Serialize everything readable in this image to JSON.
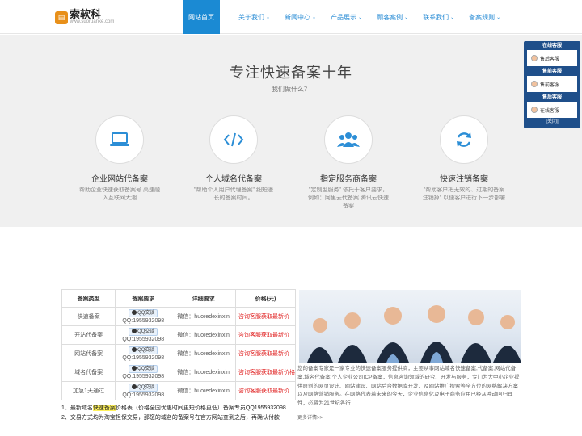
{
  "logo": {
    "text": "索软科",
    "sub": "www.suoruanke.com"
  },
  "nav": [
    {
      "label": "网站首页",
      "chev": ""
    },
    {
      "label": "关于我们",
      "chev": "⌄"
    },
    {
      "label": "新闻中心",
      "chev": "⌄"
    },
    {
      "label": "产品展示",
      "chev": "⌄"
    },
    {
      "label": "顾客案例",
      "chev": "⌄"
    },
    {
      "label": "联系我们",
      "chev": "⌄"
    },
    {
      "label": "备案规则",
      "chev": "⌄"
    }
  ],
  "hero": {
    "title": "专注快速备案十年",
    "subtitle": "我们做什么？"
  },
  "services": [
    {
      "icon": "laptop-icon",
      "title": "企业网站代备案",
      "desc": "帮助企业快速获取备案号 高速融入互联网大潮"
    },
    {
      "icon": "code-icon",
      "title": "个人域名代备案",
      "desc": "\"帮助个人用户代理备案\" 细短漫长的备案时间。"
    },
    {
      "icon": "users-icon",
      "title": "指定服务商备案",
      "desc": "\"定制型服务\" 依托于客户要求，例如：阿里云代备案 腾讯云快速备案"
    },
    {
      "icon": "refresh-icon",
      "title": "快速注销备案",
      "desc": "\"帮助客户把无效的、过期的备案注销掉\" 以便客户进行下一步部署"
    }
  ],
  "table": {
    "headers": [
      "备案类型",
      "备案要求",
      "详细要求",
      "价格(元)"
    ],
    "qq_label": "QQ交谈",
    "rows": [
      {
        "type": "快速备案",
        "qq": "QQ:1955932098",
        "wx": "微信：huoredexinxin",
        "price": "咨询客服获取最新价"
      },
      {
        "type": "开站代备案",
        "qq": "QQ:1955932098",
        "wx": "微信：huoredexinxin",
        "price": "咨询客服获取最新价"
      },
      {
        "type": "网站代备案",
        "qq": "QQ:1955932098",
        "wx": "微信：huoredexinxin",
        "price": "咨询客服获取最新价"
      },
      {
        "type": "域名代备案",
        "qq": "QQ:1955932098",
        "wx": "微信：huoredexinxin",
        "price": "咨询客服获取最新价格"
      },
      {
        "type": "加急1天通过",
        "qq": "QQ:1955932098",
        "wx": "微信：huoredexinxin",
        "price": "咨询客服获取最新价"
      }
    ]
  },
  "notes": {
    "line1_pre": "1、最新域名",
    "line1_hl": "快速备案",
    "line1_post": "价格表（价格全国优惠时间更短价格更低）备案专员QQ1955932098",
    "line2": "2、交易方式均为淘宝担保交易，那您的域名的备案号在官方网站查到之后，再确认付款"
  },
  "about": {
    "text": "您的备案专家是一家专业的快速备案服务提供商，主要从事网站域名快速备案,代备案,网站代备案,域名代备案,个人企业公司ICP备案，信息咨询领域的研究、开发与服务，专门为大中小企业提供原创的网页设计、网站建设、网站后台数据库开发、及网站推广搜索等全方位的网络解决方案以及网络营销服务。在网络代表着未来的今天，企业信息化及电子商务应用已经从冲动回归理性，必将为21世纪各行",
    "more": "更多详情>>"
  },
  "float_panel": {
    "sections": [
      {
        "title": "在线客服",
        "item": "售后客服"
      },
      {
        "title": "售前客服",
        "item": "售前客服"
      },
      {
        "title": "售后客服",
        "item": "在线客服"
      }
    ],
    "close": "[关闭]"
  },
  "colors": {
    "brand": "#1b8ad3",
    "price": "#e02020",
    "panel": "#1f4f8a"
  }
}
